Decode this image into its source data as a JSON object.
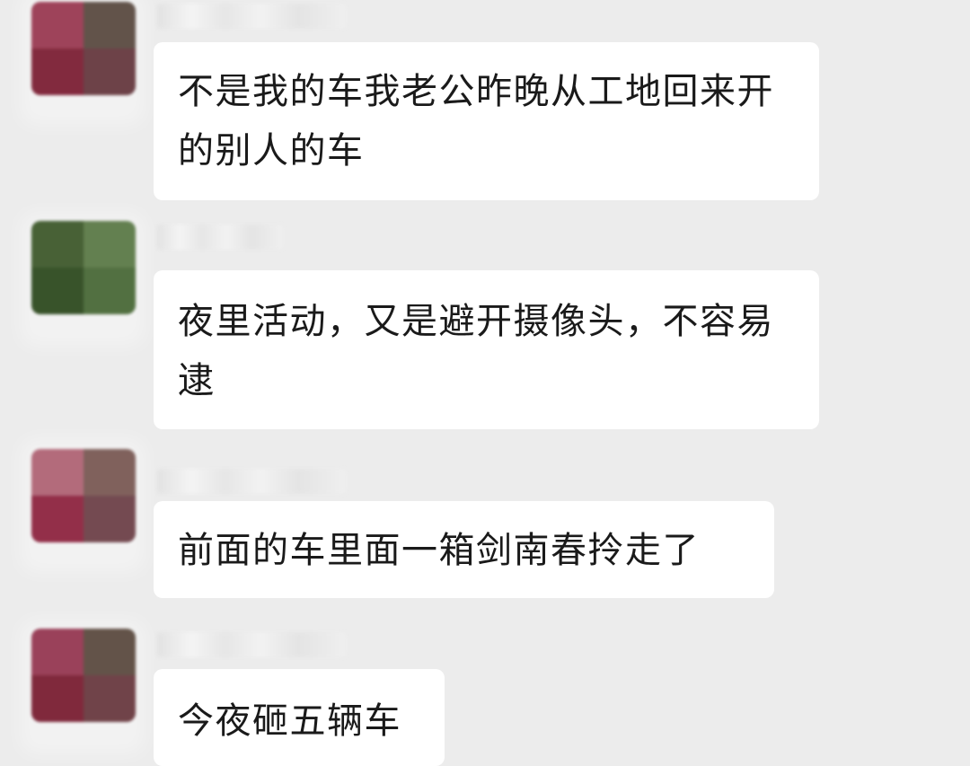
{
  "colors": {
    "background": "#ececec",
    "bubble": "#ffffff",
    "text": "#1a1a1a"
  },
  "messages": [
    {
      "avatar_colors": [
        "#9a3a52",
        "#5b4b42",
        "#7d2035",
        "#66393f"
      ],
      "text": "不是我的车我老公昨晚从工地回来开的别人的车"
    },
    {
      "avatar_colors": [
        "#3f5a2c",
        "#5c7a48",
        "#2f4b20",
        "#4a6a38"
      ],
      "text": "夜里活动，又是避开摄像头，不容易逮"
    },
    {
      "avatar_colors": [
        "#b06475",
        "#7a5a55",
        "#8e2540",
        "#6e4249"
      ],
      "text": "前面的车里面一箱剑南春拎走了"
    },
    {
      "avatar_colors": [
        "#963852",
        "#5c4b40",
        "#7a1f33",
        "#6a3a40"
      ],
      "text": "今夜砸五辆车"
    }
  ]
}
